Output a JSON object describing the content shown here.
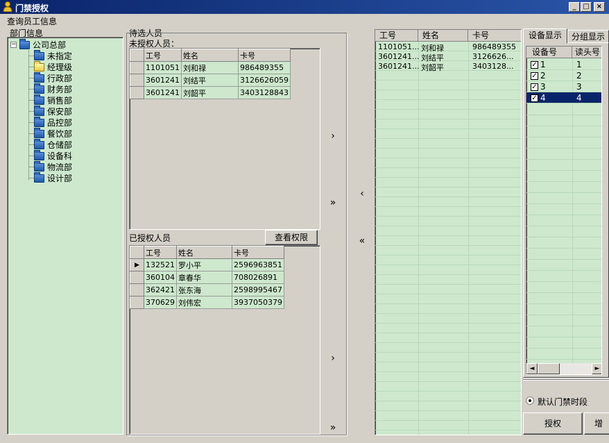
{
  "window": {
    "title": "门禁授权",
    "min": "_",
    "max": "□",
    "close": "×"
  },
  "menu": {
    "query_employee": "查询员工信息"
  },
  "dept_panel": {
    "label": "部门信息",
    "root": "公司总部",
    "expander": "−",
    "children": [
      "未指定",
      "经理级",
      "行政部",
      "财务部",
      "销售部",
      "保安部",
      "品控部",
      "餐饮部",
      "仓储部",
      "设备科",
      "物流部",
      "设计部"
    ]
  },
  "pending": {
    "group_label": "待选人员",
    "unauth_label": "未授权人员：",
    "columns": [
      "工号",
      "姓名",
      "卡号"
    ],
    "rows": [
      [
        "1101051",
        "刘和禄",
        "986489355"
      ],
      [
        "3601241",
        "刘结平",
        "3126626059"
      ],
      [
        "3601241",
        "刘韶平",
        "3403128843"
      ]
    ]
  },
  "authorized": {
    "label": "已授权人员",
    "view_button": "查看权限",
    "columns": [
      "工号",
      "姓名",
      "卡号"
    ],
    "rows": [
      [
        "132521",
        "罗小平",
        "2596963851"
      ],
      [
        "360104",
        "章春华",
        "708026891"
      ],
      [
        "362421",
        "张东海",
        "2598995467"
      ],
      [
        "370629",
        "刘伟宏",
        "3937050379"
      ]
    ],
    "current_marker": "▶"
  },
  "arrows": {
    "move_one": "›",
    "move_all": "»",
    "back_one": "‹",
    "back_all": "«"
  },
  "selected": {
    "columns": [
      "工号",
      "姓名",
      "卡号"
    ],
    "rows": [
      [
        "1101051...",
        "刘和禄",
        "986489355"
      ],
      [
        "3601241...",
        "刘结平",
        "3126626..."
      ],
      [
        "3601241...",
        "刘韶平",
        "3403128..."
      ]
    ]
  },
  "devices": {
    "tabs": [
      "设备显示",
      "分组显示"
    ],
    "columns": [
      "设备号",
      "读头号"
    ],
    "rows": [
      {
        "device": "1",
        "reader": "1",
        "checked": true
      },
      {
        "device": "2",
        "reader": "2",
        "checked": true
      },
      {
        "device": "3",
        "reader": "3",
        "checked": true
      },
      {
        "device": "4",
        "reader": "4",
        "checked": true
      }
    ],
    "check_mark": "✓",
    "scroll_left": "◄",
    "scroll_right": "►"
  },
  "options": {
    "default_period": "默认门禁时段"
  },
  "actions": {
    "authorize": "授权",
    "add": "增"
  },
  "colors": {
    "grid_bg": "#cde8cd",
    "selection": "#0a246a",
    "title_bar": "#0a246a"
  }
}
